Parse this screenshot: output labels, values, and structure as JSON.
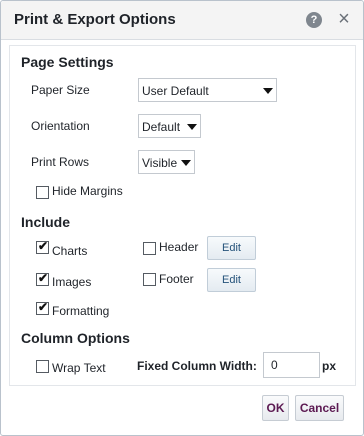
{
  "dialog": {
    "title": "Print & Export Options",
    "help_icon": "?",
    "close_icon": "×"
  },
  "page_settings": {
    "heading": "Page Settings",
    "paper_size": {
      "label": "Paper Size",
      "value": "User Default"
    },
    "orientation": {
      "label": "Orientation",
      "value": "Default"
    },
    "print_rows": {
      "label": "Print Rows",
      "value": "Visible"
    },
    "hide_margins": {
      "label": "Hide Margins",
      "checked": false
    }
  },
  "include": {
    "heading": "Include",
    "charts": {
      "label": "Charts",
      "checked": true
    },
    "images": {
      "label": "Images",
      "checked": true
    },
    "formatting": {
      "label": "Formatting",
      "checked": true
    },
    "header": {
      "label": "Header",
      "checked": false,
      "edit_label": "Edit"
    },
    "footer": {
      "label": "Footer",
      "checked": false,
      "edit_label": "Edit"
    }
  },
  "column_options": {
    "heading": "Column Options",
    "wrap_text": {
      "label": "Wrap Text",
      "checked": false
    },
    "fixed_width": {
      "label": "Fixed Column Width:",
      "value": "0",
      "unit": "px"
    }
  },
  "actions": {
    "ok_label": "OK",
    "cancel_label": "Cancel"
  },
  "check_glyph": "✔",
  "colors": {
    "accent_text": "#5c1a52",
    "edit_text": "#24527a"
  }
}
